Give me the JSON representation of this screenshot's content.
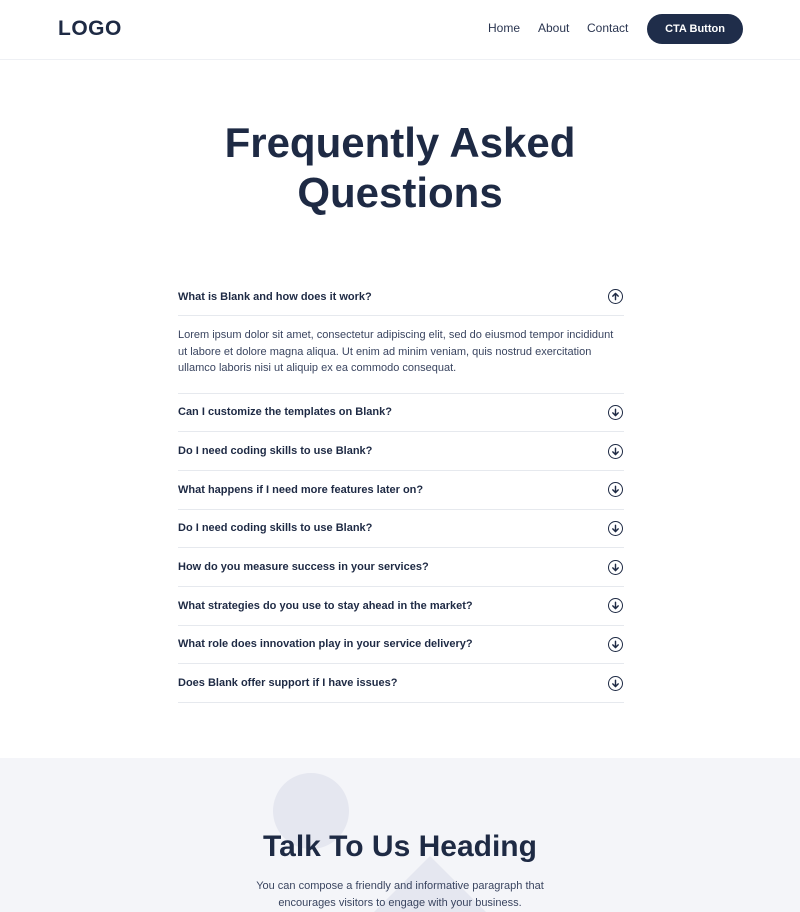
{
  "header": {
    "logo": "LOGO",
    "nav": {
      "home": "Home",
      "about": "About",
      "contact": "Contact"
    },
    "cta_label": "CTA Button"
  },
  "faq": {
    "title": "Frequently Asked Questions",
    "items": [
      {
        "question": "What is Blank and how does it work?",
        "answer": "Lorem ipsum dolor sit amet, consectetur adipiscing elit, sed do eiusmod tempor incididunt ut labore et dolore magna aliqua. Ut enim ad minim veniam, quis nostrud exercitation ullamco laboris nisi ut aliquip ex ea commodo consequat.",
        "expanded": true,
        "icon": "arrow-up-circle-icon"
      },
      {
        "question": "Can I customize the templates on Blank?",
        "expanded": false,
        "icon": "arrow-down-circle-icon"
      },
      {
        "question": "Do I need coding skills to use Blank?",
        "expanded": false,
        "icon": "arrow-down-circle-icon"
      },
      {
        "question": "What happens if I need more features later on?",
        "expanded": false,
        "icon": "arrow-down-circle-icon"
      },
      {
        "question": "Do I need coding skills to use Blank?",
        "expanded": false,
        "icon": "arrow-down-circle-icon"
      },
      {
        "question": "How do you measure success in your services?",
        "expanded": false,
        "icon": "arrow-down-circle-icon"
      },
      {
        "question": "What strategies do you use to stay ahead in the market?",
        "expanded": false,
        "icon": "arrow-down-circle-icon"
      },
      {
        "question": "What role does innovation play in your service delivery?",
        "expanded": false,
        "icon": "arrow-down-circle-icon"
      },
      {
        "question": "Does Blank offer support if I have issues?",
        "expanded": false,
        "icon": "arrow-down-circle-icon"
      }
    ]
  },
  "contact": {
    "title": "Talk To Us Heading",
    "text": "You can compose a friendly and informative paragraph that encourages visitors to engage with your business."
  },
  "colors": {
    "primary": "#1f2d4a",
    "text": "#1e2a44",
    "section_bg": "#f4f5f9",
    "decor": "#e5e7f0",
    "divider": "#e6e9ee"
  }
}
